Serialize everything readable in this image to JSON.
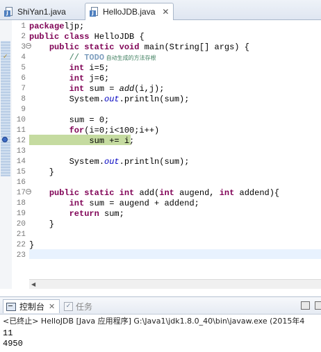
{
  "editor_tabs": [
    {
      "label": "ShiYan1.java"
    },
    {
      "label": "HelloJDB.java",
      "close": "✕"
    }
  ],
  "code_lines": [
    {
      "n": "1",
      "parts": [
        [
          "kw",
          "package"
        ],
        [
          "",
          "ljp;"
        ]
      ]
    },
    {
      "n": "2",
      "parts": [
        [
          "kw",
          "public"
        ],
        [
          "",
          " "
        ],
        [
          "kw",
          "class"
        ],
        [
          "",
          " HelloJDB {"
        ]
      ]
    },
    {
      "n": "3",
      "parts": [
        [
          "",
          "    "
        ],
        [
          "kw",
          "public"
        ],
        [
          "",
          " "
        ],
        [
          "kw",
          "static"
        ],
        [
          "",
          " "
        ],
        [
          "kw",
          "void"
        ],
        [
          "",
          " main(String[] args) {"
        ]
      ]
    },
    {
      "n": "4",
      "parts": [
        [
          "",
          "        "
        ],
        [
          "cm",
          "// "
        ],
        [
          "todo",
          "TODO"
        ],
        [
          "cm cn",
          " 自动生成的方法存根"
        ]
      ]
    },
    {
      "n": "5",
      "parts": [
        [
          "",
          "        "
        ],
        [
          "kw",
          "int"
        ],
        [
          "",
          " i=5;"
        ]
      ]
    },
    {
      "n": "6",
      "parts": [
        [
          "",
          "        "
        ],
        [
          "kw",
          "int"
        ],
        [
          "",
          " j=6;"
        ]
      ]
    },
    {
      "n": "7",
      "parts": [
        [
          "",
          "        "
        ],
        [
          "kw",
          "int"
        ],
        [
          "",
          " sum = "
        ],
        [
          "it",
          "add"
        ],
        [
          "",
          "(i,j);"
        ]
      ]
    },
    {
      "n": "8",
      "parts": [
        [
          "",
          "        System."
        ],
        [
          "fld",
          "out"
        ],
        [
          "",
          ".println(sum);"
        ]
      ]
    },
    {
      "n": "9",
      "parts": []
    },
    {
      "n": "10",
      "parts": [
        [
          "",
          "        sum = 0;"
        ]
      ]
    },
    {
      "n": "11",
      "parts": [
        [
          "",
          "        "
        ],
        [
          "kw",
          "for"
        ],
        [
          "",
          "(i=0;i<100;i++)"
        ]
      ]
    },
    {
      "n": "12",
      "parts": [
        [
          "",
          "            sum += i;"
        ]
      ]
    },
    {
      "n": "13",
      "parts": []
    },
    {
      "n": "14",
      "parts": [
        [
          "",
          "        System."
        ],
        [
          "fld",
          "out"
        ],
        [
          "",
          ".println(sum);"
        ]
      ]
    },
    {
      "n": "15",
      "parts": [
        [
          "",
          "    }"
        ]
      ]
    },
    {
      "n": "16",
      "parts": []
    },
    {
      "n": "17",
      "parts": [
        [
          "",
          "    "
        ],
        [
          "kw",
          "public"
        ],
        [
          "",
          " "
        ],
        [
          "kw",
          "static"
        ],
        [
          "",
          " "
        ],
        [
          "kw",
          "int"
        ],
        [
          "",
          " add("
        ],
        [
          "kw",
          "int"
        ],
        [
          "",
          " augend, "
        ],
        [
          "kw",
          "int"
        ],
        [
          "",
          " addend){"
        ]
      ]
    },
    {
      "n": "18",
      "parts": [
        [
          "",
          "        "
        ],
        [
          "kw",
          "int"
        ],
        [
          "",
          " sum = augend + addend;"
        ]
      ]
    },
    {
      "n": "19",
      "parts": [
        [
          "",
          "        "
        ],
        [
          "kw",
          "return"
        ],
        [
          "",
          " sum;"
        ]
      ]
    },
    {
      "n": "20",
      "parts": [
        [
          "",
          "    }"
        ]
      ]
    },
    {
      "n": "21",
      "parts": []
    },
    {
      "n": "22",
      "parts": [
        [
          "",
          "}"
        ]
      ]
    },
    {
      "n": "23",
      "parts": []
    }
  ],
  "view_tabs": {
    "console": "控制台",
    "console_close": "✕",
    "tasks": "任务"
  },
  "console": {
    "header": "<已终止> HelloJDB [Java 应用程序] G:\\Java1\\jdk1.8.0_40\\bin\\javaw.exe (2015年4",
    "output": [
      "11",
      "4950"
    ]
  },
  "colors": {
    "keyword": "#7f0055",
    "comment": "#3f7f5f",
    "static_field": "#0000c0",
    "debug_line_highlight": "#c5dba0",
    "current_line_highlight": "#e8f2fe"
  }
}
